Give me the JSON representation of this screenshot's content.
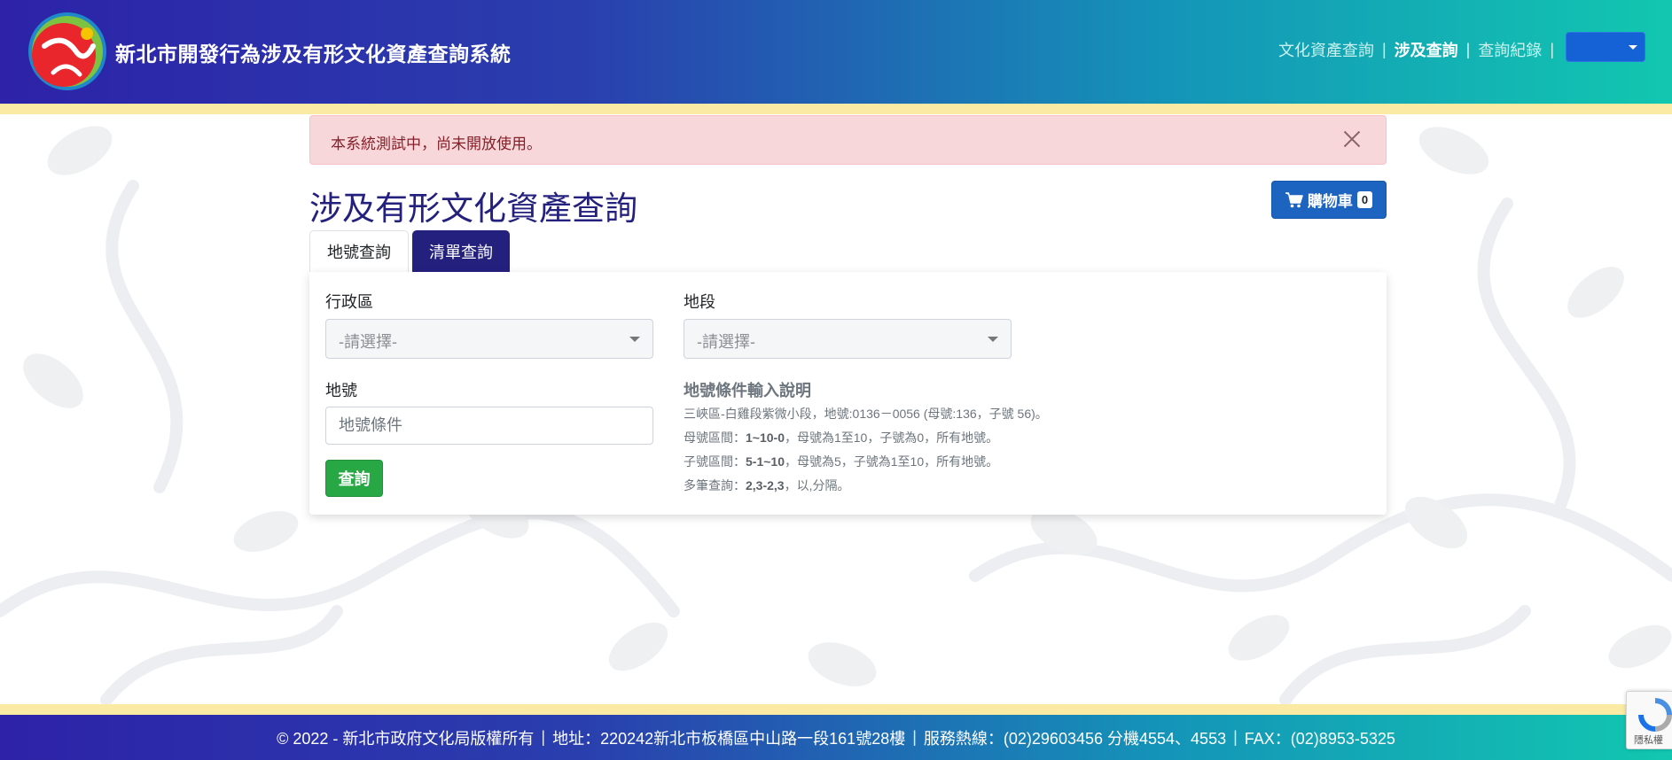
{
  "header": {
    "site_title": "新北市開發行為涉及有形文化資產查詢系統",
    "nav": [
      {
        "label": "文化資產查詢",
        "active": false
      },
      {
        "label": "涉及查詢",
        "active": true
      },
      {
        "label": "查詢紀錄",
        "active": false
      }
    ],
    "user_menu": {
      "value": ""
    }
  },
  "alert": {
    "message": "本系統測試中，尚未開放使用。"
  },
  "page": {
    "title": "涉及有形文化資產查詢"
  },
  "cart": {
    "label": "購物車",
    "count": "0"
  },
  "tabs": [
    {
      "label": "地號查詢",
      "active": true
    },
    {
      "label": "清單查詢",
      "active": false
    }
  ],
  "form": {
    "district": {
      "label": "行政區",
      "value": "-請選擇-"
    },
    "section": {
      "label": "地段",
      "value": "-請選擇-"
    },
    "lot": {
      "label": "地號",
      "placeholder": "地號條件"
    },
    "submit_label": "查詢"
  },
  "help": {
    "title": "地號條件輸入說明",
    "lines": [
      {
        "prefix": "三峽區-白雞段紫微小段，地號:0136－0056 (母號:136，子號 56)。",
        "bold": "",
        "suffix": ""
      },
      {
        "prefix": "母號區間：",
        "bold": "1~10-0",
        "suffix": "，母號為1至10，子號為0，所有地號。"
      },
      {
        "prefix": "子號區間：",
        "bold": "5-1~10",
        "suffix": "，母號為5，子號為1至10，所有地號。"
      },
      {
        "prefix": "多筆查詢：",
        "bold": "2,3-2,3",
        "suffix": "，以,分隔。"
      }
    ]
  },
  "footer": {
    "copyright": "© 2022 - 新北市政府文化局版權所有",
    "address": "地址：220242新北市板橋區中山路一段161號28樓",
    "hotline": "服務熱線：(02)29603456 分機4554、4553",
    "fax": "FAX：(02)8953-5325"
  },
  "recaptcha": {
    "text": "隱私權"
  },
  "colors": {
    "header_start": "#2d22a8",
    "header_end": "#12c7b0",
    "stripe": "#fbeaa3",
    "title": "#24207e",
    "cart": "#1c64c0",
    "submit": "#28a745",
    "alert_bg": "#f8d7da"
  }
}
